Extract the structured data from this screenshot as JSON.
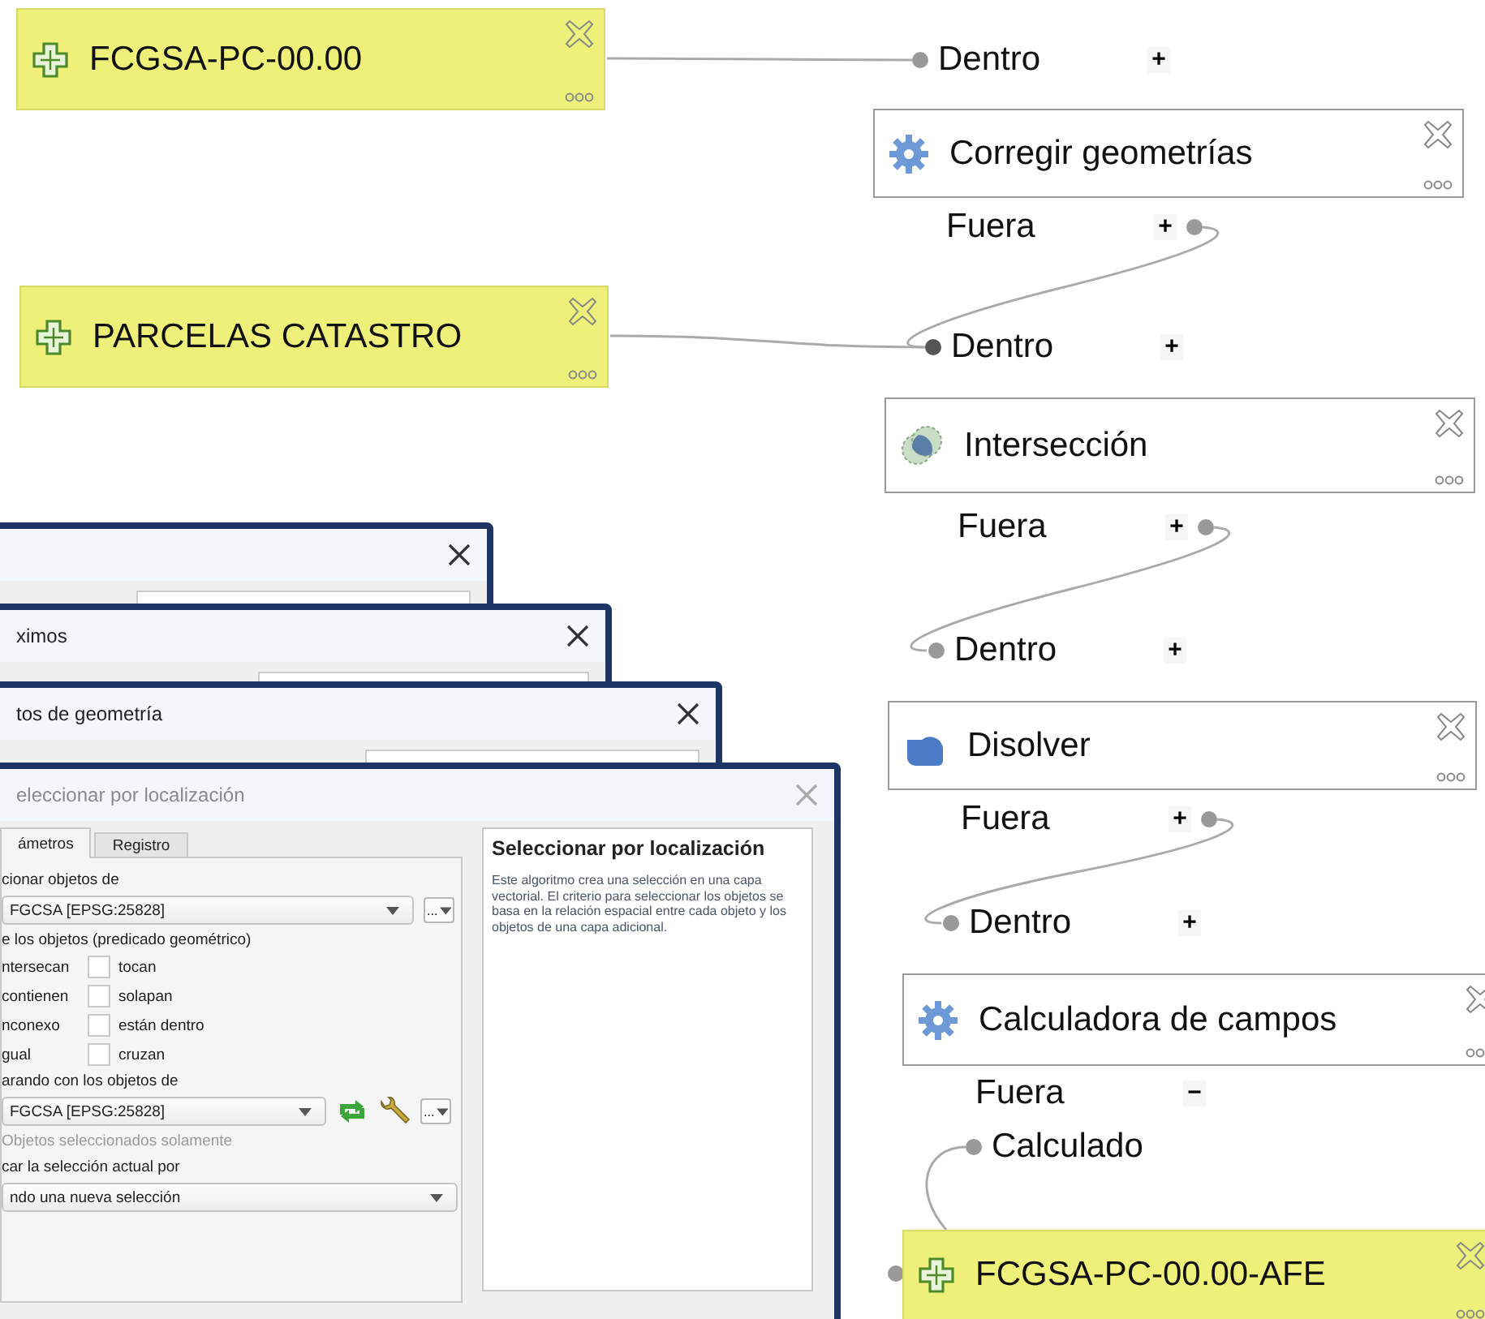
{
  "canvas": {
    "inputs": [
      {
        "label": "FCGSA-PC-00.00"
      },
      {
        "label": "PARCELAS CATASTRO"
      }
    ],
    "steps": [
      {
        "title": "Corregir geometrías",
        "input": {
          "label": "Dentro",
          "toggle": "+"
        },
        "output": {
          "label": "Fuera",
          "toggle": "+"
        }
      },
      {
        "title": "Intersección",
        "input": {
          "label": "Dentro",
          "toggle": "+"
        },
        "output": {
          "label": "Fuera",
          "toggle": "+"
        }
      },
      {
        "title": "Disolver",
        "input": {
          "label": "Dentro",
          "toggle": "+"
        },
        "output": {
          "label": "Fuera",
          "toggle": "+"
        }
      },
      {
        "title": "Calculadora de campos",
        "input": {
          "label": "Dentro",
          "toggle": "+"
        },
        "output": {
          "label": "Fuera",
          "toggle": "−",
          "children": [
            "Calculado"
          ]
        }
      }
    ],
    "result": {
      "label": "FCGSA-PC-00.00-AFE"
    }
  },
  "windows": [
    {
      "kind": "window"
    },
    {
      "kind": "window",
      "title": "ximos"
    },
    {
      "kind": "window",
      "title": "tos de geometría"
    }
  ],
  "dialog": {
    "title": "eleccionar por localización",
    "tabs": [
      {
        "label": "ámetros",
        "selected": true
      },
      {
        "label": "Registro",
        "selected": false
      }
    ],
    "source_label": "cionar objetos de",
    "source_layer": "FGCSA [EPSG:25828]",
    "source_more": "...",
    "predicate_label": "e los objetos (predicado geométrico)",
    "predicates": [
      {
        "left": "ntersecan",
        "right": "tocan",
        "checked": false
      },
      {
        "left": "contienen",
        "right": "solapan",
        "checked": false
      },
      {
        "left": "nconexo",
        "right": "están dentro",
        "checked": false
      },
      {
        "left": "gual",
        "right": "cruzan",
        "checked": false
      }
    ],
    "compare_label": "arando con los objetos de",
    "compare_layer": "FGCSA [EPSG:25828]",
    "compare_more": "...",
    "selected_only": {
      "label": "Objetos seleccionados solamente",
      "disabled": true
    },
    "mode_label": "car la selección actual por",
    "mode": "ndo una nueva selección",
    "help": {
      "title": "Seleccionar por localización",
      "text": "Este algoritmo crea una selección en una capa vectorial. El criterio para seleccionar los objetos se basa en la relación espacial entre cada objeto y los objetos de una capa adicional."
    }
  }
}
